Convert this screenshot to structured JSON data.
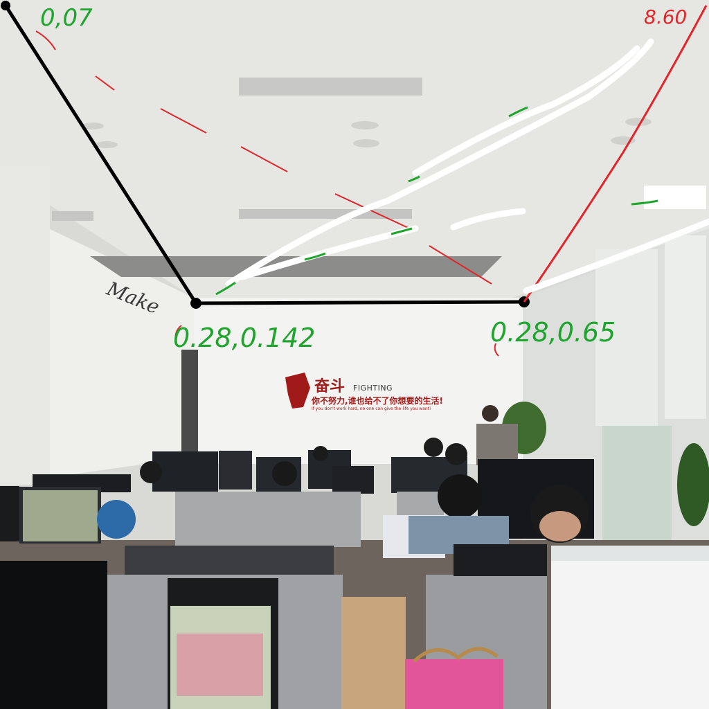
{
  "annotations": {
    "top_left": "0,07",
    "top_right": "8.60",
    "mid_left": "0.28,0.142",
    "mid_right": "0.28,0.65"
  },
  "wall_slogan": {
    "title_cn": "奋斗",
    "title_en": "FIGHTING",
    "line_cn": "你不努力,谁也给不了你想要的生活!",
    "line_en": "If you don't work hard, no one can give the life you want!"
  },
  "wall_script": "Make",
  "colors": {
    "ceiling": "#e9e9e6",
    "wall": "#f1f1ef",
    "slogan_red": "#a11a1a",
    "annotation_green": "#1fa52e",
    "annotation_red": "#e0262a",
    "annotation_black": "#000000",
    "annotation_white": "#ffffff"
  }
}
